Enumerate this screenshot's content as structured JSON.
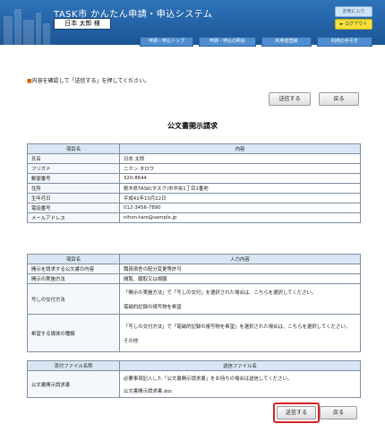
{
  "header": {
    "app_title": "TASK市 かんたん申請・申込システム",
    "user_name": "日本 太郎 様",
    "favorites_label": "お気に入り",
    "logout_label": "ログアウト"
  },
  "nav": [
    "申請・申込トップ",
    "申請・申込の照会",
    "利用者登録",
    "利用の手引き"
  ],
  "instruction": {
    "mark": "■",
    "text": "内容を確認して「送信する」を押してください。"
  },
  "buttons": {
    "send": "送信する",
    "back": "戻る"
  },
  "page_title": "公文書開示請求",
  "applicant_table": {
    "headers": [
      "項目名",
      "内容"
    ],
    "rows": [
      {
        "label": "氏名",
        "value": "日本 太郎"
      },
      {
        "label": "フリガナ",
        "value": "ニホン タロウ"
      },
      {
        "label": "郵便番号",
        "value": "320-8644"
      },
      {
        "label": "住所",
        "value": "栃木県TASK(タスク)市中央1丁目1番地"
      },
      {
        "label": "生年月日",
        "value": "平成41年10月22日"
      },
      {
        "label": "電話番号",
        "value": "012-3456-7890"
      },
      {
        "label": "メールアドレス",
        "value": "nihon-taro@sample.jp"
      }
    ]
  },
  "request_table": {
    "headers": [
      "項目名",
      "入力内容"
    ],
    "rows": [
      {
        "label": "開示を請求する公文書の内容",
        "value": "職員宿舎の配分変更等許可"
      },
      {
        "label": "開示の実施方法",
        "value": "閲覧、聴取又は視聴"
      },
      {
        "label": "写しの交付方法",
        "value": "「開示の実施方法」で「写しの交付」を選択された場合は、こちらを選択してください。",
        "value2": "電磁的記録の視写物を希望"
      },
      {
        "label": "希望する媒体の種類",
        "value": "「写しの交付方法」で「電磁的記録の複写物を希望」を選択された場合は、こちらを選択してください。",
        "value2": "その他"
      }
    ]
  },
  "attachment_table": {
    "headers": [
      "添付ファイル名称",
      "送信ファイル名"
    ],
    "rows": [
      {
        "label": "公文書開示請求書",
        "value": "必要事項記入した「公文書開示請求書」をお持ちの場合は送信してください。",
        "value2": "公文書開示請求書.doc"
      }
    ]
  }
}
